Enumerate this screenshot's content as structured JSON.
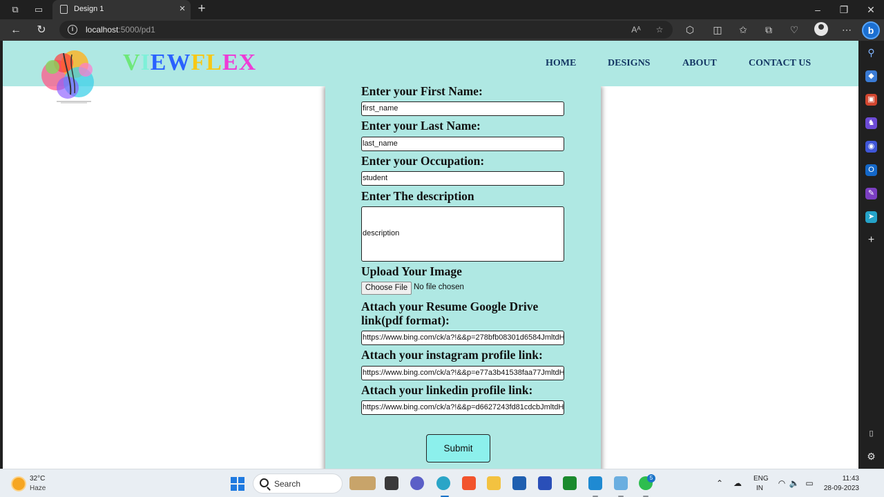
{
  "browser": {
    "tab_title": "Design 1",
    "new_tab_symbol": "+",
    "close_symbol": "×",
    "url_host": "localhost",
    "url_path": ":5000/pd1",
    "window_controls": {
      "minimize": "–",
      "restore": "❐",
      "close": "✕"
    }
  },
  "site": {
    "brand": [
      "V",
      "I",
      "E",
      "W",
      "F",
      "L",
      "E",
      "X"
    ],
    "brand_colors": [
      "#6ee87a",
      "#7ef0d8",
      "#2a62ff",
      "#2a62ff",
      "#f7c816",
      "#f7c816",
      "#ee3bd6",
      "#ee3bd6"
    ],
    "nav": [
      "HOME",
      "DESIGNS",
      "ABOUT",
      "CONTACT US"
    ]
  },
  "form": {
    "first_name_label": "Enter your First Name:",
    "first_name_value": "first_name",
    "last_name_label": "Enter your Last Name:",
    "last_name_value": "last_name",
    "occupation_label": "Enter your Occupation:",
    "occupation_value": "student",
    "description_label": "Enter The description",
    "description_value": "description",
    "upload_label": "Upload Your Image",
    "choose_file": "Choose File",
    "no_file": "No file chosen",
    "resume_label": "Attach your Resume Google Drive link(pdf format):",
    "resume_value": "https://www.bing.com/ck/a?!&&p=278bfb08301d6584JmltdH",
    "instagram_label": "Attach your instagram profile link:",
    "instagram_value": "https://www.bing.com/ck/a?!&&p=e77a3b41538faa77JmltdH",
    "linkedin_label": "Attach your linkedin profile link:",
    "linkedin_value": "https://www.bing.com/ck/a?!&&p=d6627243fd81cdcbJmltdH",
    "submit": "Submit"
  },
  "taskbar": {
    "temperature": "32°C",
    "weather": "Haze",
    "search_placeholder": "Search",
    "lang_top": "ENG",
    "lang_bottom": "IN",
    "time": "11:43",
    "date": "28-09-2023",
    "whatsapp_badge": "5"
  }
}
